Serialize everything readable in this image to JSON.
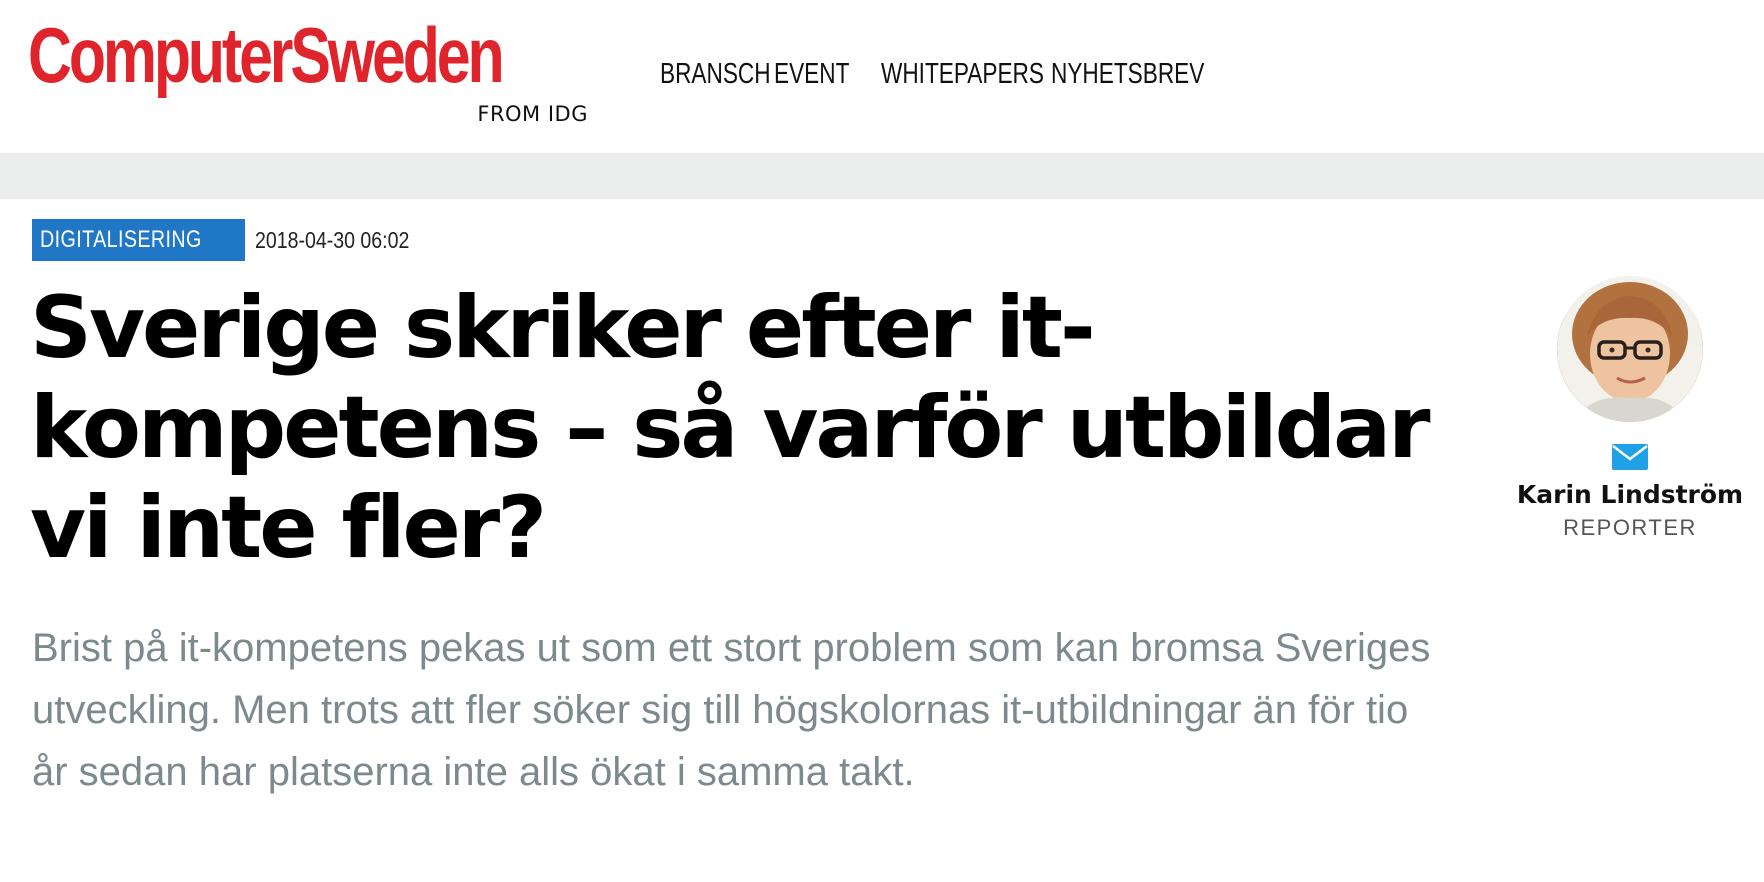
{
  "header": {
    "logo_text": "ComputerSweden",
    "logo_sub": "FROM IDG",
    "nav": [
      {
        "label": "BRANSCH"
      },
      {
        "label": "EVENT"
      },
      {
        "label": "WHITEPAPERS"
      },
      {
        "label": "NYHETSBREV"
      }
    ]
  },
  "article": {
    "category": "DIGITALISERING",
    "date": "2018-04-30 06:02",
    "title": "Sverige skriker efter it-kompetens – så varför utbildar vi inte fler?",
    "lead": "Brist på it-kompetens pekas ut som ett stort problem som kan bromsa Sveriges utveckling. Men trots att fler söker sig till högskolornas it-utbildningar än för tio år sedan har platserna inte alls ökat i samma takt."
  },
  "author": {
    "name": "Karin Lindström",
    "role": "REPORTER",
    "icon": "mail-icon"
  },
  "colors": {
    "brand_red": "#e0242b",
    "category_blue": "#2077c5",
    "lead_gray": "#7d8a8d",
    "band_gray": "#eceeee",
    "mail_blue": "#1ea1e6"
  }
}
